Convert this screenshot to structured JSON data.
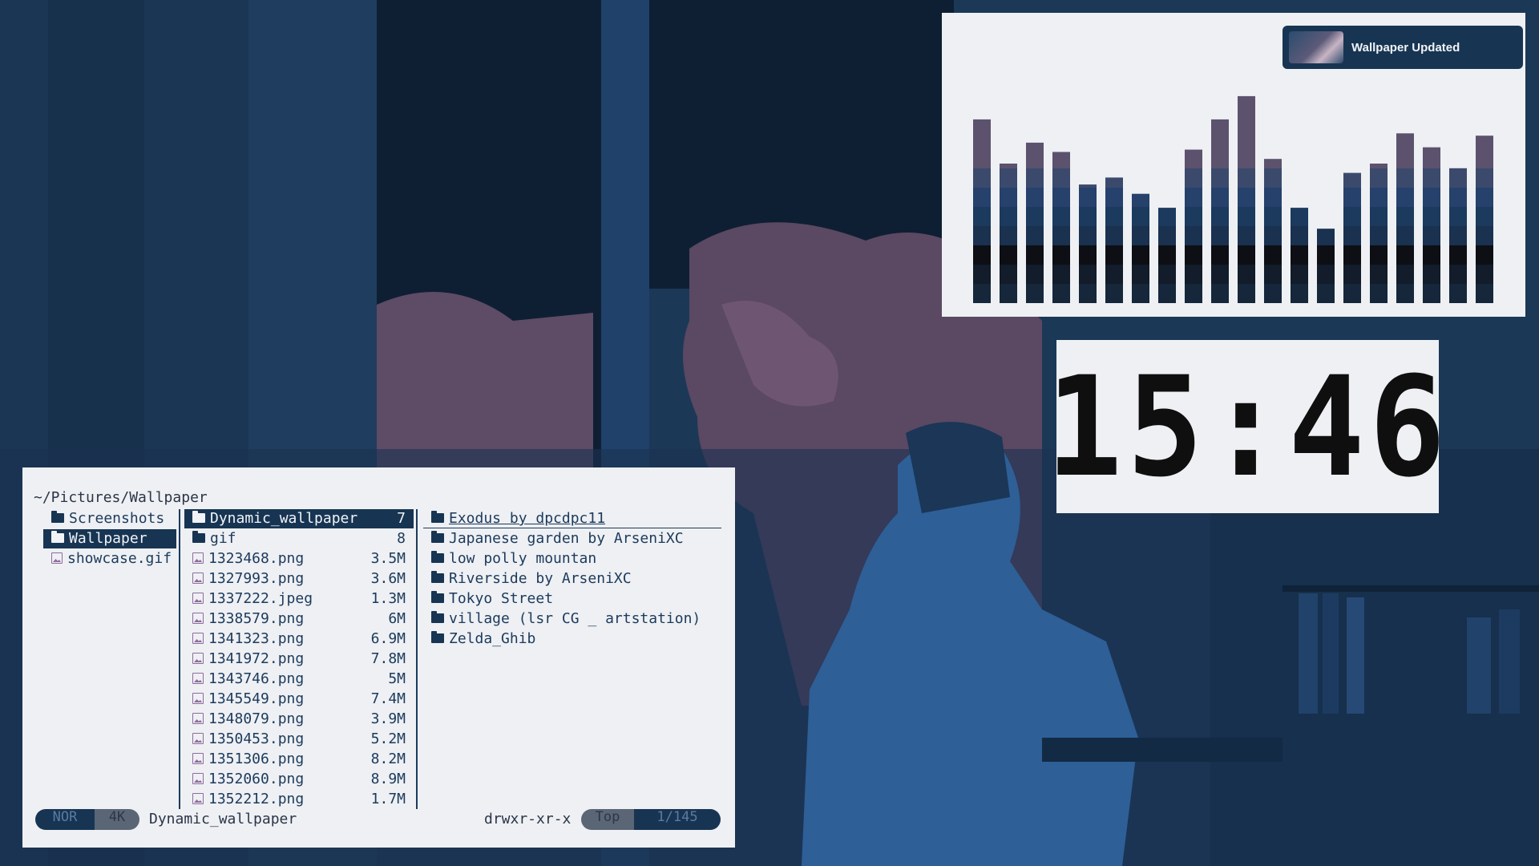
{
  "notification": {
    "title": "Wallpaper Updated"
  },
  "clock": {
    "time": "15:46"
  },
  "visualizer": {
    "levels": [
      0.79,
      0.6,
      0.69,
      0.65,
      0.51,
      0.54,
      0.47,
      0.41,
      0.66,
      0.79,
      0.89,
      0.62,
      0.41,
      0.32,
      0.56,
      0.6,
      0.73,
      0.67,
      0.58,
      0.72
    ]
  },
  "file_manager": {
    "path": "~/Pictures/Wallpaper",
    "parent_column": [
      {
        "name": "Screenshots",
        "icon": "folder-icon"
      },
      {
        "name": "Wallpaper",
        "icon": "folder-icon",
        "selected": true
      },
      {
        "name": "showcase.gif",
        "icon": "image-file-icon"
      }
    ],
    "current_column": [
      {
        "name": "Dynamic_wallpaper",
        "size": "7",
        "icon": "folder-icon",
        "selected": true
      },
      {
        "name": "gif",
        "size": "8",
        "icon": "folder-icon"
      },
      {
        "name": "1323468.png",
        "size": "3.5M",
        "icon": "image-file-icon"
      },
      {
        "name": "1327993.png",
        "size": "3.6M",
        "icon": "image-file-icon"
      },
      {
        "name": "1337222.jpeg",
        "size": "1.3M",
        "icon": "image-file-icon"
      },
      {
        "name": "1338579.png",
        "size": "6M",
        "icon": "image-file-icon"
      },
      {
        "name": "1341323.png",
        "size": "6.9M",
        "icon": "image-file-icon"
      },
      {
        "name": "1341972.png",
        "size": "7.8M",
        "icon": "image-file-icon"
      },
      {
        "name": "1343746.png",
        "size": "5M",
        "icon": "image-file-icon"
      },
      {
        "name": "1345549.png",
        "size": "7.4M",
        "icon": "image-file-icon"
      },
      {
        "name": "1348079.png",
        "size": "3.9M",
        "icon": "image-file-icon"
      },
      {
        "name": "1350453.png",
        "size": "5.2M",
        "icon": "image-file-icon"
      },
      {
        "name": "1351306.png",
        "size": "8.2M",
        "icon": "image-file-icon"
      },
      {
        "name": "1352060.png",
        "size": "8.9M",
        "icon": "image-file-icon"
      },
      {
        "name": "1352212.png",
        "size": "1.7M",
        "icon": "image-file-icon"
      }
    ],
    "preview_column": [
      {
        "name": "Exodus by dpcdpc11",
        "icon": "folder-icon",
        "hovered": true
      },
      {
        "name": "Japanese garden by ArseniXC",
        "icon": "folder-icon"
      },
      {
        "name": "low polly mountan",
        "icon": "folder-icon"
      },
      {
        "name": "Riverside by ArseniXC",
        "icon": "folder-icon"
      },
      {
        "name": "Tokyo Street",
        "icon": "folder-icon"
      },
      {
        "name": "village (lsr CG _ artstation)",
        "icon": "folder-icon"
      },
      {
        "name": "Zelda_Ghib",
        "icon": "folder-icon"
      }
    ],
    "status_bar": {
      "mode": "NOR",
      "size": "4K",
      "current_name": "Dynamic_wallpaper",
      "permissions": "drwxr-xr-x",
      "position": "Top",
      "count": "1/145"
    }
  },
  "colors": {
    "panel_bg": "#eef0f3",
    "accent": "#173553",
    "image_icon": "#8f6c9e"
  }
}
